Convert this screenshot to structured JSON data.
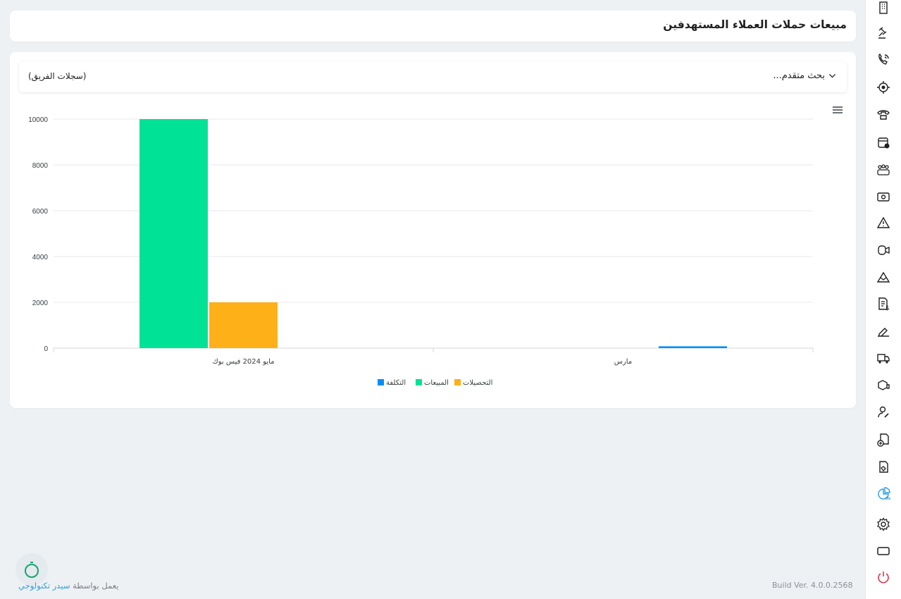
{
  "header": {
    "title": "مبيعات حملات العملاء المستهدفين"
  },
  "filters": {
    "advanced_search_label": "بحث متقدم...",
    "team_records_label": "(سجلات الفريق)"
  },
  "chart_data": {
    "type": "bar",
    "categories": [
      "مايو 2024 فيس بوك",
      "مارس"
    ],
    "series": [
      {
        "name": "المبيعات",
        "values": [
          10000,
          0
        ],
        "color": "#00e396"
      },
      {
        "name": "التحصيلات",
        "values": [
          2000,
          0
        ],
        "color": "#feb019"
      },
      {
        "name": "التكلفة",
        "values": [
          0,
          80
        ],
        "color": "#008ffb"
      }
    ],
    "ylim": [
      0,
      10000
    ],
    "yticks": [
      "10000",
      "8000",
      "6000",
      "4000",
      "2000",
      "0"
    ],
    "legend_order": [
      "التكلفة",
      "المبيعات",
      "التحصيلات"
    ],
    "legend_position": "bottom-center",
    "grid": true
  },
  "footer": {
    "powered_by": "يعمل بواسطة",
    "brand": "سيدر تكنولوجي",
    "build": "Build Ver. 4.0.0.2568"
  },
  "sidebar": {
    "icons": [
      "building-icon",
      "gavel-icon",
      "phone-call-icon",
      "target-icon",
      "telephone-icon",
      "calendar-add-icon",
      "team-icon",
      "money-icon",
      "warning-icon",
      "video-icon",
      "mountain-icon",
      "invoice-dollar-icon",
      "signature-icon",
      "truck-icon",
      "delivery-icon",
      "user-edit-icon",
      "document-add-icon",
      "document-hand-icon",
      "chart-pie-icon",
      "gear-icon",
      "window-icon",
      "power-icon"
    ],
    "active_icon": "chart-pie-icon",
    "active_color": "#2f9de0",
    "power_color": "#e0334a"
  }
}
